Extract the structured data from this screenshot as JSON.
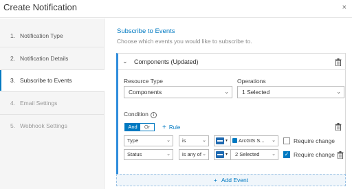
{
  "window": {
    "title": "Create Notification",
    "close_glyph": "×"
  },
  "steps": [
    {
      "num": "1.",
      "label": "Notification Type",
      "state": "done"
    },
    {
      "num": "2.",
      "label": "Notification Details",
      "state": "done"
    },
    {
      "num": "3.",
      "label": "Subscribe to Events",
      "state": "active"
    },
    {
      "num": "4.",
      "label": "Email Settings",
      "state": "pending"
    },
    {
      "num": "5.",
      "label": "Webhook Settings",
      "state": "pending"
    }
  ],
  "section": {
    "title": "Subscribe to Events",
    "subtitle": "Choose which events you would like to subscribe to."
  },
  "event_card": {
    "title": "Components (Updated)",
    "resource_type_label": "Resource Type",
    "resource_type_value": "Components",
    "operations_label": "Operations",
    "operations_value": "1 Selected",
    "condition_label": "Condition",
    "and_label": "And",
    "or_label": "Or",
    "add_rule_label": "Rule",
    "rules": [
      {
        "field": "Type",
        "operator": "is",
        "value": "ArcGIS S...",
        "require_change_label": "Require change",
        "require_change": false
      },
      {
        "field": "Status",
        "operator": "is any of",
        "value": "2 Selected",
        "require_change_label": "Require change",
        "require_change": true
      }
    ]
  },
  "add_event_label": "Add Event",
  "colors": {
    "accent": "#0079c1",
    "card_border": "#2f8ddc"
  }
}
